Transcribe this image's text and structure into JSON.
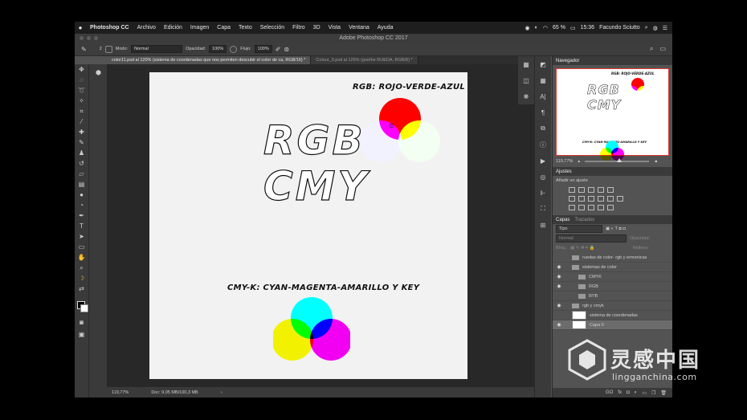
{
  "menubar": {
    "apple": "",
    "items": [
      "Photoshop CC",
      "Archivo",
      "Edición",
      "Imagen",
      "Capa",
      "Texto",
      "Selección",
      "Filtro",
      "3D",
      "Vista",
      "Ventana",
      "Ayuda"
    ],
    "battery": "65 %",
    "time": "15:36",
    "user": "Facundo Sciutto"
  },
  "window": {
    "title": "Adobe Photoshop CC 2017"
  },
  "options": {
    "mode_label": "Modo:",
    "mode_value": "Normal",
    "opacity_label": "Opacidad:",
    "opacity_value": "100%",
    "flow_label": "Flujo:",
    "flow_value": "100%",
    "brush_size": "2"
  },
  "tabs": [
    {
      "label": "color11.psd al 120% (sistema de coordenadas que nos permiten descubir el color de ca, RGB/16) *"
    },
    {
      "label": "Colour_3.psd al 126% (goethe RUEDA, RGB/8) *"
    }
  ],
  "document": {
    "rgb_label": "RGB: ROJO-VERDE-AZUL",
    "title1": "RGB",
    "title2": "CMY",
    "cmyk_label": "CMY-K: CYAN-MAGENTA-AMARILLO Y KEY",
    "colors": {
      "red": "#ff0000",
      "green": "#00ff00",
      "blue": "#0000ff",
      "cyan": "#00ffff",
      "magenta": "#ff00ff",
      "yellow": "#ffff00"
    }
  },
  "status": {
    "zoom": "119,77%",
    "doc": "Doc: 9,05 MB/100,3 MB"
  },
  "navigator": {
    "title": "Navegador",
    "zoom": "119,77%",
    "thumb_rgb": "RGB: ROJO-VERDE-AZUL",
    "thumb_t1": "RGB",
    "thumb_t2": "CMY",
    "thumb_cmyk": "CMY-K: CYAN-MAGENTA-AMARILLO Y KEY"
  },
  "adjustments": {
    "title": "Ajustes",
    "subtitle": "Añadir un ajuste"
  },
  "layers": {
    "tab1": "Capas",
    "tab2": "Trazados",
    "kind": "Tipo",
    "blend": "Normal",
    "opacity_label": "Opacidad:",
    "lock_label": "Bloq.:",
    "fill_label": "Relleno:",
    "rows": [
      {
        "name": "ruedas de color- rgb y ermonicas",
        "indent": 0,
        "eye": false,
        "type": "folder"
      },
      {
        "name": "sistemas de color",
        "indent": 0,
        "eye": true,
        "type": "folder"
      },
      {
        "name": "CMYK",
        "indent": 1,
        "eye": true,
        "type": "folder"
      },
      {
        "name": "RGB",
        "indent": 1,
        "eye": true,
        "type": "folder"
      },
      {
        "name": "RYB",
        "indent": 1,
        "eye": false,
        "type": "folder"
      },
      {
        "name": "rgb y cmyk",
        "indent": 0,
        "eye": true,
        "type": "folder"
      },
      {
        "name": "sistema de coordenadas",
        "indent": 0,
        "eye": false,
        "type": "layer"
      },
      {
        "name": "Capa 0",
        "indent": 0,
        "eye": true,
        "type": "layer"
      }
    ],
    "footer": [
      "GO",
      "fx",
      "◘",
      "◐",
      "▭",
      "❐",
      "🗑"
    ]
  },
  "watermark": {
    "text": "灵感中国",
    "url": "lingganchina.com"
  }
}
